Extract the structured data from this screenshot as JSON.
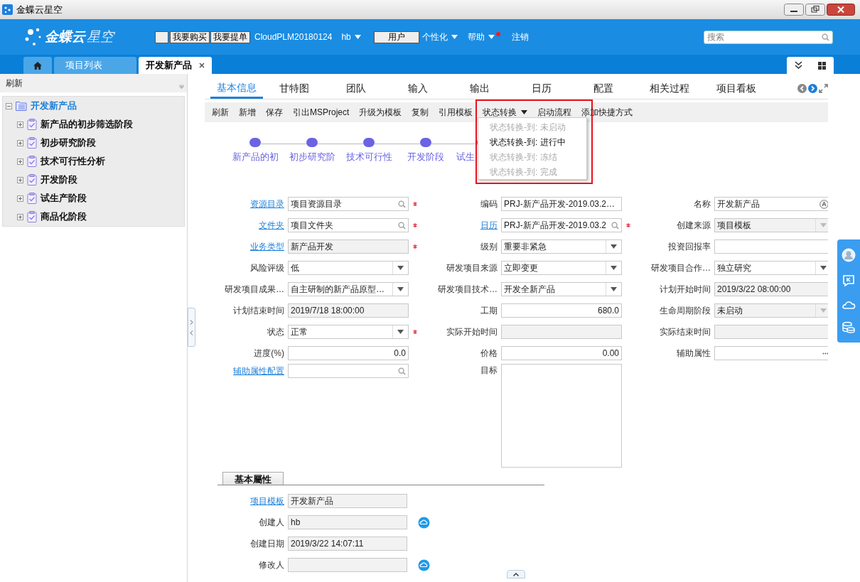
{
  "window": {
    "title": "金蝶云星空"
  },
  "header": {
    "logo": {
      "brand": "金蝶云",
      "product": "星空"
    },
    "buttons": [
      {
        "label": "我要购买"
      },
      {
        "label": "我要提单"
      }
    ],
    "account": "CloudPLM20180124",
    "user_menu": "hb",
    "role_button": "用户",
    "menus": [
      {
        "label": "个性化",
        "notify": false
      },
      {
        "label": "帮助",
        "notify": true
      }
    ],
    "logout": "注销",
    "search": {
      "placeholder": "搜索"
    }
  },
  "page_tabs": [
    {
      "kind": "home",
      "selected": false
    },
    {
      "kind": "text",
      "label": "项目列表",
      "selected": false,
      "closable": false
    },
    {
      "kind": "text",
      "label": "开发新产品",
      "selected": true,
      "closable": true
    }
  ],
  "sidebar": {
    "toolbar": "刷新",
    "tree": [
      {
        "label": "开发新产品",
        "expanded": true,
        "selected": true,
        "children": [
          {
            "label": "新产品的初步筛选阶段",
            "expanded": false,
            "selected": false
          },
          {
            "label": "初步研究阶段",
            "expanded": false,
            "selected": false
          },
          {
            "label": "技术可行性分析",
            "expanded": false,
            "selected": false
          },
          {
            "label": "开发阶段",
            "expanded": false,
            "selected": false
          },
          {
            "label": "试生产阶段",
            "expanded": false,
            "selected": false
          },
          {
            "label": "商品化阶段",
            "expanded": false,
            "selected": false
          }
        ]
      }
    ]
  },
  "detail_tabs": [
    {
      "label": "基本信息",
      "selected": true
    },
    {
      "label": "甘特图",
      "selected": false
    },
    {
      "label": "团队",
      "selected": false
    },
    {
      "label": "输入",
      "selected": false
    },
    {
      "label": "输出",
      "selected": false
    },
    {
      "label": "日历",
      "selected": false
    },
    {
      "label": "配置",
      "selected": false
    },
    {
      "label": "相关过程",
      "selected": false
    },
    {
      "label": "项目看板",
      "selected": false
    }
  ],
  "toolbar": [
    {
      "label": "刷新",
      "has_menu": false
    },
    {
      "label": "新增",
      "has_menu": false
    },
    {
      "label": "保存",
      "has_menu": false
    },
    {
      "label": "引出MSProject",
      "has_menu": false
    },
    {
      "label": "升级为模板",
      "has_menu": false
    },
    {
      "label": "复制",
      "has_menu": false
    },
    {
      "label": "引用模板",
      "has_menu": false
    },
    {
      "label": "状态转换",
      "has_menu": true
    },
    {
      "label": "启动流程",
      "has_menu": false
    },
    {
      "label": "添加快捷方式",
      "has_menu": false
    }
  ],
  "status_menu": [
    {
      "label": "状态转换-到: 未启动",
      "disabled": true
    },
    {
      "label": "状态转换-到: 进行中",
      "disabled": false
    },
    {
      "label": "状态转换-到: 冻结",
      "disabled": true
    },
    {
      "label": "状态转换-到: 完成",
      "disabled": true
    }
  ],
  "stages": [
    {
      "label": "新产品的初"
    },
    {
      "label": "初步研究阶"
    },
    {
      "label": "技术可行性"
    },
    {
      "label": "开发阶段"
    },
    {
      "label": "试生"
    }
  ],
  "form": {
    "rows": [
      [
        {
          "label": "资源目录",
          "link": true,
          "kind": "lookup",
          "value": "项目资源目录",
          "required": true,
          "readonly": false
        },
        {
          "label": "编码",
          "link": false,
          "kind": "text",
          "value": "PRJ-新产品开发-2019.03.2…",
          "required": false,
          "readonly": false
        },
        {
          "label": "名称",
          "link": false,
          "kind": "multilang",
          "value": "开发新产品",
          "required": false,
          "readonly": false
        }
      ],
      [
        {
          "label": "文件夹",
          "link": true,
          "kind": "lookup",
          "value": "项目文件夹",
          "required": true,
          "readonly": false
        },
        {
          "label": "日历",
          "link": true,
          "kind": "lookup",
          "value": "PRJ-新产品开发-2019.03.2",
          "required": true,
          "readonly": false
        },
        {
          "label": "创建来源",
          "link": false,
          "kind": "combo",
          "value": "项目模板",
          "required": false,
          "readonly": true
        }
      ],
      [
        {
          "label": "业务类型",
          "link": true,
          "kind": "text",
          "value": "新产品开发",
          "required": true,
          "readonly": true
        },
        {
          "label": "级别",
          "link": false,
          "kind": "combo",
          "value": "重要非紧急",
          "required": false,
          "readonly": false
        },
        {
          "label": "投资回报率",
          "link": false,
          "kind": "text",
          "required": false,
          "readonly": false
        }
      ],
      [
        {
          "label": "风险评级",
          "link": false,
          "kind": "combo",
          "value": "低",
          "required": false,
          "readonly": false
        },
        {
          "label": "研发项目来源",
          "link": false,
          "kind": "combo",
          "value": "立即变更",
          "required": false,
          "readonly": false
        },
        {
          "label": "研发项目合作…",
          "link": false,
          "kind": "combo",
          "value": "独立研究",
          "required": false,
          "readonly": false
        }
      ],
      [
        {
          "label": "研发项目成果…",
          "link": false,
          "kind": "combo",
          "value": "自主研制的新产品原型…",
          "required": false,
          "readonly": false
        },
        {
          "label": "研发项目技术…",
          "link": false,
          "kind": "combo",
          "value": "开发全新产品",
          "required": false,
          "readonly": false
        },
        {
          "label": "计划开始时间",
          "link": false,
          "kind": "text",
          "value": "2019/3/22 08:00:00",
          "required": false,
          "readonly": true
        }
      ],
      [
        {
          "label": "计划结束时间",
          "link": false,
          "kind": "text",
          "value": "2019/7/18 18:00:00",
          "required": false,
          "readonly": true
        },
        {
          "label": "工期",
          "link": false,
          "kind": "number",
          "value": "680.0",
          "required": false,
          "readonly": false
        },
        {
          "label": "生命周期阶段",
          "link": false,
          "kind": "combo",
          "value": "未启动",
          "required": false,
          "readonly": true
        }
      ],
      [
        {
          "label": "状态",
          "link": false,
          "kind": "combo",
          "value": "正常",
          "required": true,
          "readonly": false
        },
        {
          "label": "实际开始时间",
          "link": false,
          "kind": "text",
          "required": false,
          "readonly": true
        },
        {
          "label": "实际结束时间",
          "link": false,
          "kind": "text",
          "required": false,
          "readonly": true
        }
      ],
      [
        {
          "label": "进度(%)",
          "link": false,
          "kind": "number",
          "value": "0.0",
          "required": false,
          "readonly": false
        },
        {
          "label": "价格",
          "link": false,
          "kind": "number",
          "value": "0.00",
          "required": false,
          "readonly": false
        },
        {
          "label": "辅助属性",
          "link": false,
          "kind": "ellipsis",
          "required": false,
          "readonly": false
        }
      ],
      [
        {
          "label": "辅助属性配置",
          "link": true,
          "kind": "lookup",
          "required": false,
          "readonly": false
        },
        {
          "label": "目标",
          "link": false,
          "kind": "textarea",
          "required": false,
          "readonly": false
        },
        null
      ]
    ]
  },
  "section": {
    "title": "基本屬性",
    "rows": [
      {
        "label": "项目模板",
        "link": true,
        "value": "开发新产品",
        "readonly": true,
        "action": false
      },
      {
        "label": "创建人",
        "link": false,
        "value": "hb",
        "readonly": true,
        "action": true
      },
      {
        "label": "创建日期",
        "link": false,
        "value": "2019/3/22 14:07:11",
        "readonly": true,
        "action": false
      },
      {
        "label": "修改人",
        "link": false,
        "readonly": true,
        "action": true
      }
    ]
  }
}
